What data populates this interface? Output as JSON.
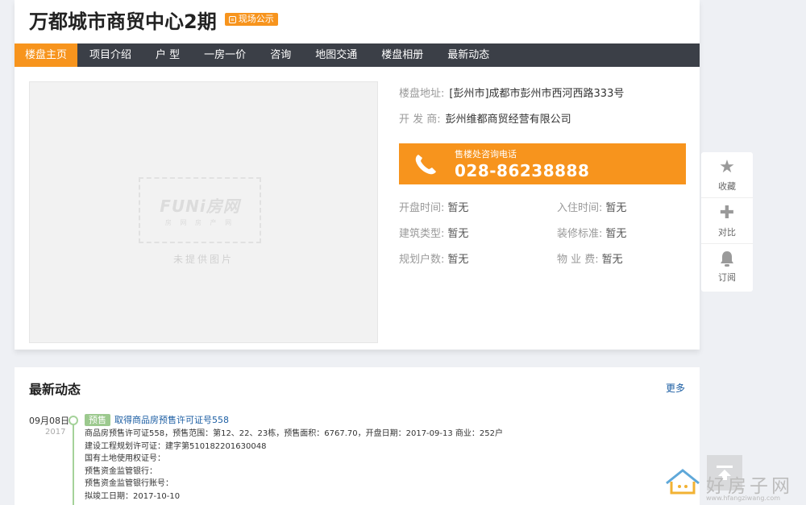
{
  "header": {
    "title": "万都城市商贸中心2期",
    "badge": "现场公示",
    "badge_icon": "chat-icon"
  },
  "nav": {
    "items": [
      "楼盘主页",
      "项目介绍",
      "户 型",
      "一房一价",
      "咨询",
      "地图交通",
      "楼盘相册",
      "最新动态"
    ],
    "active_index": 0
  },
  "photo": {
    "logo": "FUNi房网",
    "logo_sub": "房 网 房 产 网",
    "caption": "未提供图片"
  },
  "info": {
    "address_label": "楼盘地址:",
    "address_value": "[彭州市]成都市彭州市西河西路333号",
    "developer_label": "开 发 商:",
    "developer_value": "彭州维都商贸经营有限公司"
  },
  "phone": {
    "label": "售楼处咨询电话",
    "number": "028-86238888",
    "icon": "phone-icon"
  },
  "attributes": [
    [
      {
        "label": "开盘时间:",
        "value": "暂无"
      },
      {
        "label": "入住时间:",
        "value": "暂无"
      }
    ],
    [
      {
        "label": "建筑类型:",
        "value": "暂无"
      },
      {
        "label": "装修标准:",
        "value": "暂无"
      }
    ],
    [
      {
        "label": "规划户数:",
        "value": "暂无"
      },
      {
        "label": "物 业 费:",
        "value": "暂无"
      }
    ]
  ],
  "side_tools": [
    {
      "label": "收藏",
      "icon": "star-icon"
    },
    {
      "label": "对比",
      "icon": "plus-icon"
    },
    {
      "label": "订阅",
      "icon": "bell-icon"
    }
  ],
  "news": {
    "heading": "最新动态",
    "more": "更多",
    "items": [
      {
        "date": "09月08日",
        "year": "2017",
        "tag": "预售",
        "title": "取得商品房预售许可证号558",
        "lines": [
          "商品房预售许可证558，预售范围：第12、22、23栋，预售面积：6767.70，开盘日期：2017-09-13 商业：252户",
          "建设工程规划许可证：建字第510182201630048",
          "国有土地使用权证号：",
          "预售资金监管银行：",
          "预售资金监管银行账号：",
          "拟竣工日期：2017-10-10"
        ]
      }
    ]
  },
  "watermark": {
    "text": "好房子网",
    "url": "www.hfangziwang.com"
  },
  "colors": {
    "accent": "#f7941d",
    "nav_bg": "#3b3f47",
    "link": "#1c5ea3",
    "timeline": "#a5d29a"
  }
}
